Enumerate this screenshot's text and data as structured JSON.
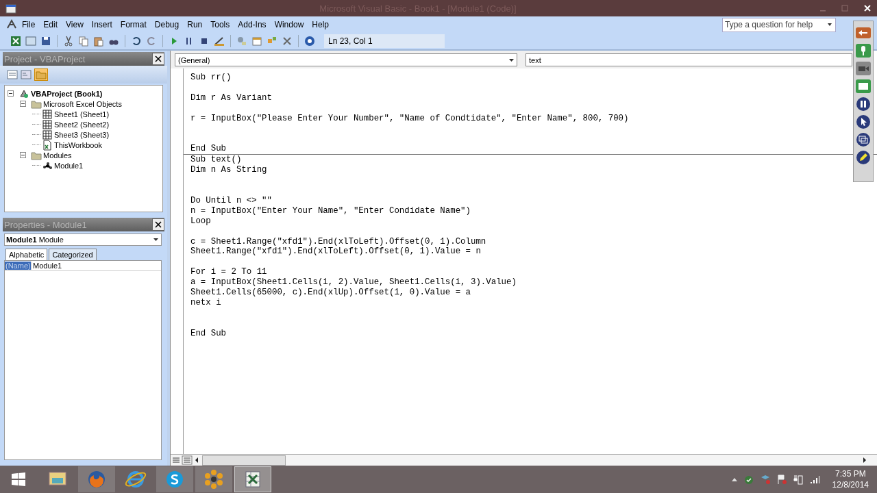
{
  "window": {
    "title": "Microsoft Visual Basic - Book1 - [Module1 (Code)]"
  },
  "menu": [
    "File",
    "Edit",
    "View",
    "Insert",
    "Format",
    "Debug",
    "Run",
    "Tools",
    "Add-Ins",
    "Window",
    "Help"
  ],
  "help_box": {
    "placeholder": "Type a question for help"
  },
  "toolbar": {
    "position": "Ln 23, Col 1"
  },
  "project_pane": {
    "title": "Project - VBAProject",
    "tree": [
      {
        "label": "VBAProject (Book1)",
        "kind": "project",
        "expanded": true,
        "children": [
          {
            "label": "Microsoft Excel Objects",
            "kind": "folder",
            "expanded": true,
            "children": [
              {
                "label": "Sheet1 (Sheet1)",
                "kind": "sheet"
              },
              {
                "label": "Sheet2 (Sheet2)",
                "kind": "sheet"
              },
              {
                "label": "Sheet3 (Sheet3)",
                "kind": "sheet"
              },
              {
                "label": "ThisWorkbook",
                "kind": "workbook"
              }
            ]
          },
          {
            "label": "Modules",
            "kind": "folder",
            "expanded": true,
            "children": [
              {
                "label": "Module1",
                "kind": "module"
              }
            ]
          }
        ]
      }
    ]
  },
  "properties_pane": {
    "title": "Properties - Module1",
    "object_name": "Module1",
    "object_type": "Module",
    "tabs": [
      {
        "label": "Alphabetic",
        "selected": true
      },
      {
        "label": "Categorized",
        "selected": false
      }
    ],
    "rows": [
      {
        "name": "(Name)",
        "value": "Module1",
        "selected": true
      }
    ]
  },
  "code_window": {
    "object_combo": "(General)",
    "procedure_combo": "text",
    "procedures": [
      {
        "text": "Sub rr()\n\nDim r As Variant\n\nr = InputBox(\"Please Enter Your Number\", \"Name of Condtidate\", \"Enter Name\", 800, 700)\n\n\nEnd Sub"
      },
      {
        "text": "Sub text()\nDim n As String\n\n\nDo Until n <> \"\"\nn = InputBox(\"Enter Your Name\", \"Enter Condidate Name\")\nLoop\n\nc = Sheet1.Range(\"xfd1\").End(xlToLeft).Offset(0, 1).Column\nSheet1.Range(\"xfd1\").End(xlToLeft).Offset(0, 1).Value = n\n\nFor i = 2 To 11\na = InputBox(Sheet1.Cells(i, 2).Value, Sheet1.Cells(i, 3).Value)\nSheet1.Cells(65000, c).End(xlUp).Offset(1, 0).Value = a\nnetx i\n\n\nEnd Sub"
      }
    ]
  },
  "taskbar": {
    "apps": [
      {
        "kind": "explorer",
        "running": false,
        "active": false
      },
      {
        "kind": "firefox",
        "running": true,
        "active": false
      },
      {
        "kind": "ie",
        "running": false,
        "active": false
      },
      {
        "kind": "skype",
        "running": true,
        "active": false
      },
      {
        "kind": "flower",
        "running": true,
        "active": false
      },
      {
        "kind": "excel",
        "running": true,
        "active": true
      }
    ],
    "time": "7:35 PM",
    "date": "12/8/2014"
  }
}
